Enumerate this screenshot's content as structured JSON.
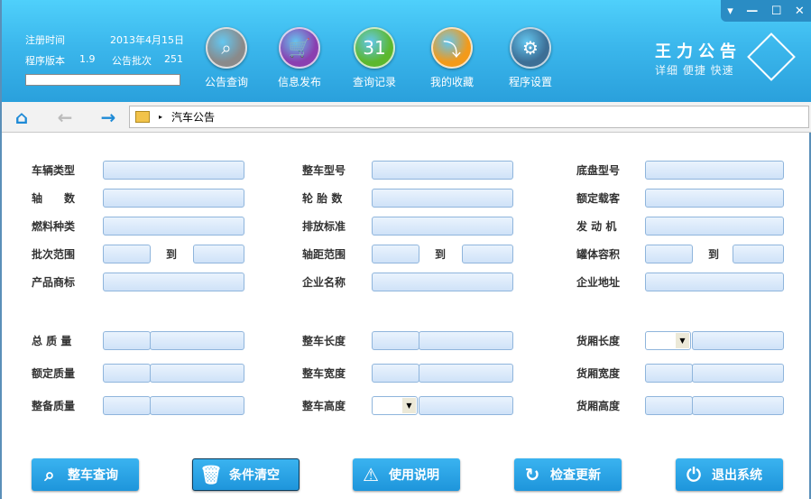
{
  "header": {
    "reg_label": "注册时间",
    "reg_date": "2013年4月15日",
    "ver_label": "程序版本",
    "version": "1.9",
    "batch_label": "公告批次",
    "batch": "251",
    "tools": [
      {
        "label": "公告查询",
        "icon": "announcement-search-icon",
        "color": "#8a8a8a",
        "glyph": "⌕"
      },
      {
        "label": "信息发布",
        "icon": "cart-icon",
        "color": "#8a3fb0",
        "glyph": "🛒"
      },
      {
        "label": "查询记录",
        "icon": "calendar-icon",
        "color": "#5cb82e",
        "glyph": "31"
      },
      {
        "label": "我的收藏",
        "icon": "favorites-icon",
        "color": "#f39a1a",
        "glyph": "⤵"
      },
      {
        "label": "程序设置",
        "icon": "gear-icon",
        "color": "#3d6f96",
        "glyph": "⚙"
      }
    ],
    "brand_title": "王力公告",
    "brand_slogan": "详细 便捷 快速"
  },
  "window_controls": [
    "▾",
    "—",
    "☐",
    "✕"
  ],
  "nav": {
    "breadcrumb": "汽车公告"
  },
  "form": {
    "range_to": "到",
    "rows": [
      [
        {
          "label": "车辆类型",
          "type": "text"
        },
        {
          "label": "整车型号",
          "type": "text"
        },
        {
          "label": "底盘型号",
          "type": "text"
        }
      ],
      [
        {
          "label": "轴　　数",
          "type": "text"
        },
        {
          "label": "轮 胎 数",
          "type": "text"
        },
        {
          "label": "额定载客",
          "type": "text"
        }
      ],
      [
        {
          "label": "燃料种类",
          "type": "text"
        },
        {
          "label": "排放标准",
          "type": "text"
        },
        {
          "label": "发 动 机",
          "type": "text"
        }
      ],
      [
        {
          "label": "批次范围",
          "type": "range"
        },
        {
          "label": "轴距范围",
          "type": "range"
        },
        {
          "label": "罐体容积",
          "type": "range"
        }
      ],
      [
        {
          "label": "产品商标",
          "type": "text"
        },
        {
          "label": "企业名称",
          "type": "text"
        },
        {
          "label": "企业地址",
          "type": "text"
        }
      ],
      [
        {
          "label": "总 质 量",
          "type": "split"
        },
        {
          "label": "整车长度",
          "type": "split"
        },
        {
          "label": "货厢长度",
          "type": "select"
        }
      ],
      [
        {
          "label": "额定质量",
          "type": "split"
        },
        {
          "label": "整车宽度",
          "type": "split"
        },
        {
          "label": "货厢宽度",
          "type": "split"
        }
      ],
      [
        {
          "label": "整备质量",
          "type": "split"
        },
        {
          "label": "整车高度",
          "type": "select"
        },
        {
          "label": "货厢高度",
          "type": "split"
        }
      ]
    ]
  },
  "buttons": [
    {
      "label": "整车查询",
      "icon": "search-icon",
      "glyph": "⌕"
    },
    {
      "label": "条件清空",
      "icon": "trash-icon",
      "glyph": "🗑"
    },
    {
      "label": "使用说明",
      "icon": "warning-icon",
      "glyph": "⚠"
    },
    {
      "label": "检查更新",
      "icon": "refresh-icon",
      "glyph": "↻"
    },
    {
      "label": "退出系统",
      "icon": "power-icon",
      "glyph": "⏻"
    }
  ]
}
